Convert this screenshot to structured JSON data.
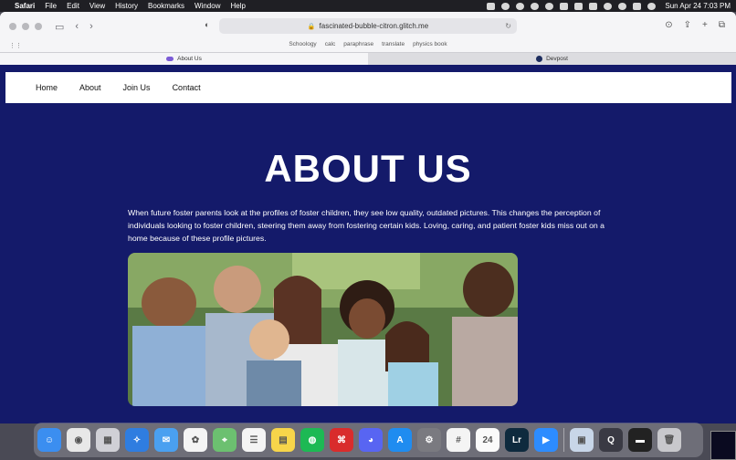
{
  "menubar": {
    "apple": "",
    "items": [
      "Safari",
      "File",
      "Edit",
      "View",
      "History",
      "Bookmarks",
      "Window",
      "Help"
    ],
    "datetime": "Sun Apr 24  7:03 PM"
  },
  "browser": {
    "url": "fascinated-bubble-citron.glitch.me",
    "bookmarks": [
      "Schoology",
      "calc",
      "paraphrase",
      "translate",
      "physics book"
    ],
    "tabs": [
      {
        "title": "About Us",
        "active": true
      },
      {
        "title": "Devpost",
        "active": false
      }
    ]
  },
  "page": {
    "nav": [
      "Home",
      "About",
      "Join Us",
      "Contact"
    ],
    "title": "ABOUT US",
    "intro": "When future foster parents look at the profiles of foster children, they see low quality, outdated pictures. This changes the perception of individuals looking to foster children, steering them away from fostering certain kids. Loving, caring, and patient foster kids miss out on a home because of these profile pictures.",
    "background_color": "#141a6a"
  },
  "dock": {
    "apps": [
      {
        "name": "finder-icon",
        "color": "#3b8ef0",
        "glyph": "☺"
      },
      {
        "name": "chrome-icon",
        "color": "#e8e8e8",
        "glyph": "◉"
      },
      {
        "name": "launchpad-icon",
        "color": "#d0d0d6",
        "glyph": "▦"
      },
      {
        "name": "safari-icon",
        "color": "#2f7de0",
        "glyph": "✧"
      },
      {
        "name": "mail-icon",
        "color": "#4aa0f0",
        "glyph": "✉"
      },
      {
        "name": "photos-icon",
        "color": "#f4f4f4",
        "glyph": "✿"
      },
      {
        "name": "maps-icon",
        "color": "#6cc070",
        "glyph": "⌖"
      },
      {
        "name": "reminders-icon",
        "color": "#f4f4f4",
        "glyph": "☰"
      },
      {
        "name": "notes-icon",
        "color": "#f7d54a",
        "glyph": "▤"
      },
      {
        "name": "spotify-icon",
        "color": "#1db954",
        "glyph": "◍"
      },
      {
        "name": "acrobat-icon",
        "color": "#d92c2c",
        "glyph": "⌘"
      },
      {
        "name": "discord-icon",
        "color": "#5865f2",
        "glyph": "◕"
      },
      {
        "name": "app-store-icon",
        "color": "#1f8cf0",
        "glyph": "A"
      },
      {
        "name": "system-preferences-icon",
        "color": "#7a7a80",
        "glyph": "⚙"
      },
      {
        "name": "slack-icon",
        "color": "#f4f4f4",
        "glyph": "#"
      },
      {
        "name": "calendar-icon",
        "color": "#fafafa",
        "glyph": "24"
      },
      {
        "name": "lightroom-icon",
        "color": "#0e2a3e",
        "glyph": "Lr"
      },
      {
        "name": "zoom-icon",
        "color": "#2d8cff",
        "glyph": "▶"
      }
    ],
    "right_apps": [
      {
        "name": "preview-icon",
        "color": "#c8d6e8",
        "glyph": "▣"
      },
      {
        "name": "quicktime-icon",
        "color": "#3a3a44",
        "glyph": "Q"
      },
      {
        "name": "screenshot-icon",
        "color": "#222",
        "glyph": "▬"
      },
      {
        "name": "trash-icon",
        "color": "#c8c8cc",
        "glyph": "🗑"
      }
    ]
  }
}
